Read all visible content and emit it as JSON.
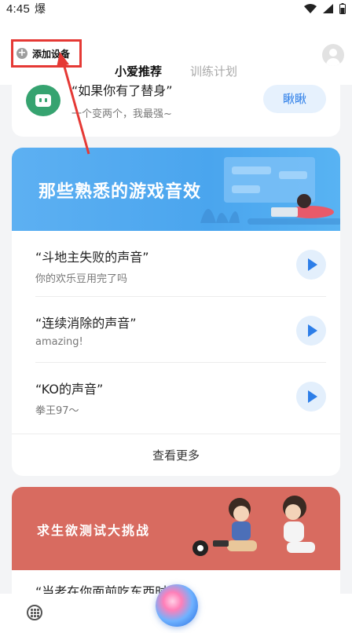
{
  "status_bar": {
    "time": "4:45",
    "extra": "爆"
  },
  "header": {
    "add_device_label": "添加设备",
    "tabs": [
      {
        "label": "小爱推荐",
        "active": true
      },
      {
        "label": "训练计划",
        "active": false
      }
    ]
  },
  "top_card": {
    "title": "“如果你有了替身”",
    "subtitle": "一个变两个，我最强~",
    "button_label": "瞅瞅"
  },
  "game_sounds": {
    "banner_title": "那些熟悉的游戏音效",
    "items": [
      {
        "title": "“斗地主失败的声音”",
        "subtitle": "你的欢乐豆用完了吗"
      },
      {
        "title": "“连续消除的声音”",
        "subtitle": "amazing!"
      },
      {
        "title": "“KO的声音”",
        "subtitle": "拳王97～"
      }
    ],
    "more_label": "查看更多"
  },
  "challenge": {
    "banner_title": "求生欲测试大挑战",
    "peek_title": "“当老在你面前吃东西时”"
  },
  "colors": {
    "accent": "#2d7ee8",
    "annotation": "#e53935",
    "banner_blue": "#4aa5ee",
    "banner_red": "#d86b60"
  }
}
